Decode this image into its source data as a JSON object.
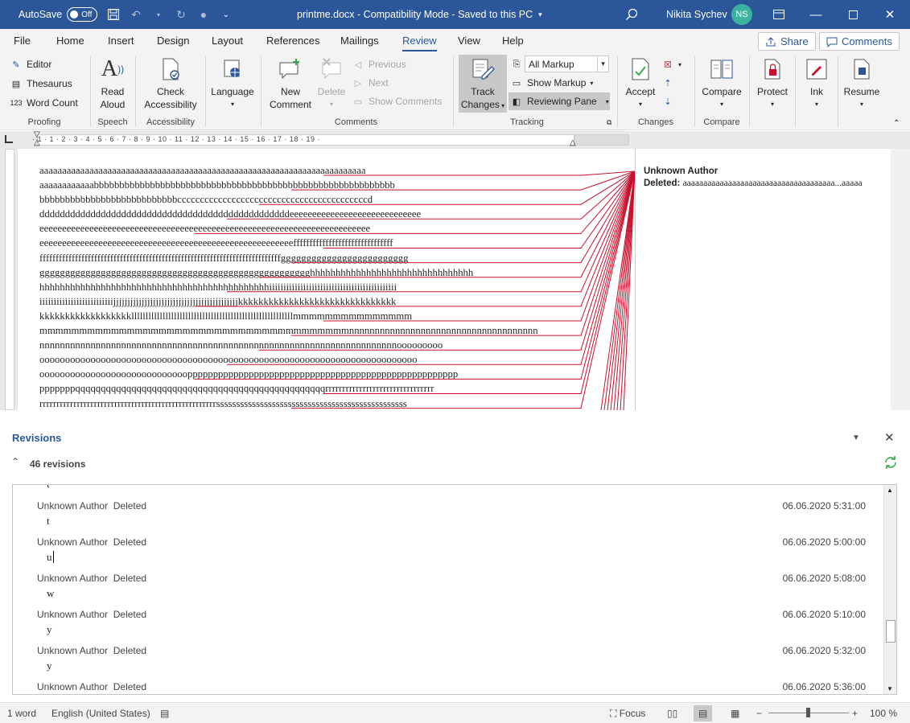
{
  "titlebar": {
    "autosave_label": "AutoSave",
    "autosave_state": "Off",
    "doc_title": "printme.docx  -  Compatibility Mode  -  Saved to this PC",
    "user_name": "Nikita Sychev",
    "user_initials": "NS"
  },
  "menu": {
    "tabs": [
      "File",
      "Home",
      "Insert",
      "Design",
      "Layout",
      "References",
      "Mailings",
      "Review",
      "View",
      "Help"
    ],
    "active": "Review",
    "share_label": "Share",
    "comments_label": "Comments"
  },
  "ribbon": {
    "proofing": {
      "editor": "Editor",
      "thesaurus": "Thesaurus",
      "word_count": "Word Count",
      "group": "Proofing"
    },
    "speech": {
      "read_aloud_1": "Read",
      "read_aloud_2": "Aloud",
      "group": "Speech"
    },
    "accessibility": {
      "check_1": "Check",
      "check_2": "Accessibility",
      "group": "Accessibility"
    },
    "language": {
      "label": "Language"
    },
    "comments": {
      "new_1": "New",
      "new_2": "Comment",
      "delete": "Delete",
      "previous": "Previous",
      "next": "Next",
      "show": "Show Comments",
      "group": "Comments"
    },
    "tracking": {
      "track_1": "Track",
      "track_2": "Changes",
      "markup_value": "All Markup",
      "show_markup": "Show Markup",
      "reviewing_pane": "Reviewing Pane",
      "group": "Tracking"
    },
    "changes": {
      "accept": "Accept",
      "group": "Changes"
    },
    "compare": {
      "compare": "Compare",
      "group": "Compare"
    },
    "protect": {
      "label": "Protect"
    },
    "ink": {
      "label": "Ink"
    },
    "resume": {
      "label": "Resume"
    }
  },
  "ruler": {
    "numbers": "· 1 · 1 · 2 · 3 · 4 · 5 · 6 · 7 · 8 · 9 · 10 · 11 · 12 · 13 · 14 · 15 · 16 · 17 · 18 · 19 ·"
  },
  "document": {
    "lines": [
      "aaaaaaaaaaaaaaaaaaaaaaaaaaaaaaaaaaaaaaaaaaaaaaaaaaaaaaaaaaaaaaaaaaaaaaaa",
      "aaaaaaaaaaaabbbbbbbbbbbbbbbbbbbbbbbbbbbbbbbbbbbbbbbbbbbbbbbbbbbbbbbbbbb",
      "bbbbbbbbbbbbbbbbbbbbbbbbbbbccccccccccccccccccccccccccccccccccccccccccd",
      "dddddddddddddddddddddddddddddddddddddddddddddddddeeeeeeeeeeeeeeeeeeeeeeeeeeeee",
      "eeeeeeeeeeeeeeeeeeeeeeeeeeeeeeeeeeeeeeeeeeeeeeeeeeeeeeeeeeeeeeeeeeeeeeeee",
      "eeeeeeeeeeeeeeeeeeeeeeeeeeeeeeeeeeeeeeeeeeeeeeeeeeeeeeeefffffffffffffffffffffffffffffff",
      "fffffffffffffffffffffffffffffffffffffffffffffffffffffffffffffffffffffffffffggggggggggggggggggggggggg",
      "ggggggggggggggggggggggggggggggggggggggggggggggggggggghhhhhhhhhhhhhhhhhhhhhhhhhhhhhhhh",
      "hhhhhhhhhhhhhhhhhhhhhhhhhhhhhhhhhhhhhhhhhhhhhiiiiiiiiiiiiiiiiiiiiiiiiiiiiiiiiiiiiiiiiiiiii",
      "iiiiiiiiiiiiiiiiiiiiiiiiiijjjjjjjjjjjjjjjjjjjjjjjjjjjjjjjjjjjjjjjjjjjjkkkkkkkkkkkkkkkkkkkkkkkkkkkkkkk",
      "kkkkkkkkkkkkkkkkkklllllllllllllllllllllllllllllllllllllllllllllllllllllllllmmmmmmmmmmmmmmm",
      "mmmmmmmmmmmmmmmmmmmmmmmmmmmmmmmmmmmmmmmnnnnnnnnnnnnnnnnnnnnnnnnnnnnnnnnnnnnn",
      "nnnnnnnnnnnnnnnnnnnnnnnnnnnnnnnnnnnnnnnnnnnnnnnnnnnnnnnnnnnnnnnnnnnnnnooooooooo",
      "oooooooooooooooooooooooooooooooooooooooooooooooooooooooooooooooooooooooooo",
      "oooooooooooooooooooooooooooooppppppppppppppppppppppppppppppppppppppppppppppppppppp",
      "pppppppqqqqqqqqqqqqqqqqqqqqqqqqqqqqqqqqqqqqqqqqqqqqqqqqqrrrrrrrrrrrrrrrrrrrrrrrrrrrrrrrr",
      "rrrrrrrrrrrrrrrrrrrrrrrrrrrrrrrrrrrrrrrrrrrrrrrrrrrrssssssssssssssssssssssssssssssssssssssssssssssss"
    ],
    "balloon_author": "Unknown Author",
    "balloon_label": "Deleted:",
    "balloon_text": "aaaaaaaaaaaaaaaaaaaaaaaaaaaaaaaaaaaaa...aaaaa"
  },
  "revisions": {
    "title": "Revisions",
    "count": "46 revisions",
    "partial_top": "t",
    "items": [
      {
        "author": "Unknown Author",
        "action": "Deleted",
        "time": "06.06.2020 5:31:00",
        "text": "t"
      },
      {
        "author": "Unknown Author",
        "action": "Deleted",
        "time": "06.06.2020 5:00:00",
        "text": "u"
      },
      {
        "author": "Unknown Author",
        "action": "Deleted",
        "time": "06.06.2020 5:08:00",
        "text": "w"
      },
      {
        "author": "Unknown Author",
        "action": "Deleted",
        "time": "06.06.2020 5:10:00",
        "text": "y"
      },
      {
        "author": "Unknown Author",
        "action": "Deleted",
        "time": "06.06.2020 5:32:00",
        "text": "y"
      },
      {
        "author": "Unknown Author",
        "action": "Deleted",
        "time": "06.06.2020 5:36:00",
        "text": ""
      }
    ]
  },
  "status": {
    "words": "1 word",
    "language": "English (United States)",
    "focus": "Focus",
    "zoom": "100 %"
  },
  "colors": {
    "accent": "#2b579a",
    "revision_line": "#c8102e",
    "refresh": "#3aa84a"
  }
}
